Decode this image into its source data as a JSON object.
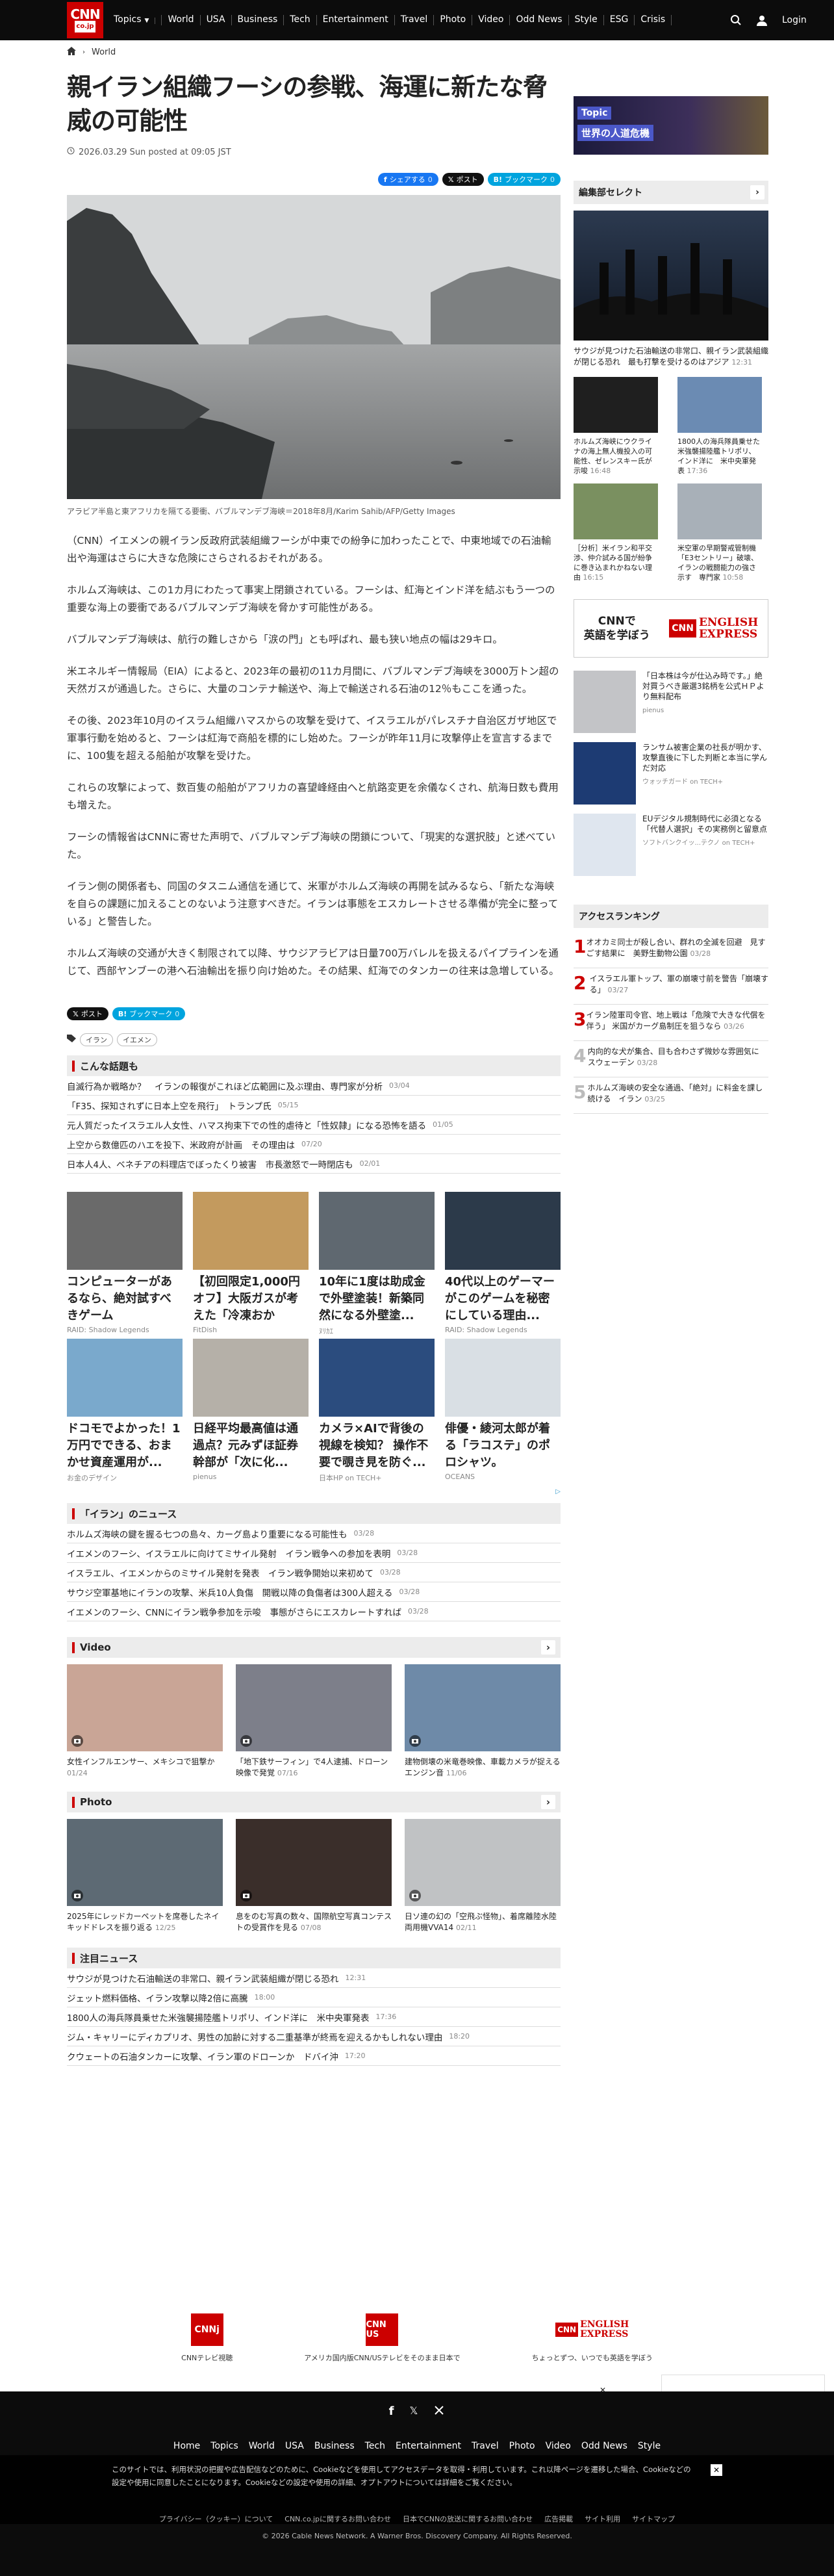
{
  "header": {
    "logo_main": "CNN",
    "logo_sub": "co.jp",
    "nav": [
      "Topics",
      "World",
      "USA",
      "Business",
      "Tech",
      "Entertainment",
      "Travel",
      "Photo",
      "Video",
      "Odd News",
      "Style",
      "ESG",
      "Crisis"
    ],
    "login": "Login"
  },
  "breadcrumb": {
    "section": "World"
  },
  "article": {
    "title": "親イラン組織フーシの参戦、海運に新たな脅威の可能性",
    "date": "2026.03.29 Sun posted at 09:05 JST",
    "share": {
      "facebook": "シェアする",
      "x": "ポスト",
      "hatena": "ブックマーク"
    },
    "caption": "アラビア半島と東アフリカを隔てる要衝、バブルマンデブ海峡＝2018年8月/Karim Sahib/AFP/Getty Images",
    "paragraphs": [
      "（CNN）イエメンの親イラン反政府武装組織フーシが中東での紛争に加わったことで、中東地域での石油輸出や海運はさらに大きな危険にさらされるおそれがある。",
      "ホルムズ海峡は、この1カ月にわたって事実上閉鎖されている。フーシは、紅海とインド洋を結ぶもう一つの重要な海上の要衝であるバブルマンデブ海峡を脅かす可能性がある。",
      "バブルマンデブ海峡は、航行の難しさから「涙の門」とも呼ばれ、最も狭い地点の幅は29キロ。",
      "米エネルギー情報局（EIA）によると、2023年の最初の11カ月間に、バブルマンデブ海峡を3000万トン超の天然ガスが通過した。さらに、大量のコンテナ輸送や、海上で輸送される石油の12％もここを通った。",
      "その後、2023年10月のイスラム組織ハマスからの攻撃を受けて、イスラエルがパレスチナ自治区ガザ地区で軍事行動を始めると、フーシは紅海で商船を標的にし始めた。フーシが昨年11月に攻撃停止を宣言するまでに、100隻を超える船舶が攻撃を受けた。",
      "これらの攻撃によって、数百隻の船舶がアフリカの喜望峰経由へと航路変更を余儀なくされ、航海日数も費用も増えた。",
      "フーシの情報省はCNNに寄せた声明で、バブルマンデブ海峡の閉鎖について、「現実的な選択肢」と述べていた。",
      "イラン側の関係者も、同国のタスニム通信を通じて、米軍がホルムズ海峡の再開を試みるなら、「新たな海峡を自らの課題に加えることのないよう注意すべきだ。イランは事態をエスカレートさせる準備が完全に整っている」と警告した。",
      "ホルムズ海峡の交通が大きく制限されて以降、サウジアラビアは日量700万バレルを扱えるパイプラインを通じて、西部ヤンブーの港へ石油輸出を振り向け始めた。その結果、紅海でのタンカーの往来は急増している。"
    ],
    "tags": [
      "イラン",
      "イエメン"
    ]
  },
  "related": {
    "heading": "こんな話題も",
    "items": [
      {
        "text": "自滅行為か戦略か？　イランの報復がこれほど広範囲に及ぶ理由、専門家が分析",
        "date": "03/04"
      },
      {
        "text": "「F35、探知されずに日本上空を飛行」　トランプ氏",
        "date": "05/15"
      },
      {
        "text": "元人質だったイスラエル人女性、ハマス拘束下での性的虐待と「性奴隷」になる恐怖を語る",
        "date": "01/05"
      },
      {
        "text": "上空から数億匹のハエを投下、米政府が計画　その理由は",
        "date": "07/20"
      },
      {
        "text": "日本人4人、ベネチアの料理店でぼったくり被害　市長激怒で一時閉店も",
        "date": "02/01"
      }
    ]
  },
  "ads": [
    {
      "title": "コンピューターがあるなら、絶対試すべきゲーム",
      "source": "RAID: Shadow Legends"
    },
    {
      "title": "【初回限定1,000円オフ】大阪ガスが考えた「冷凍おかず」...",
      "source": "FitDish"
    },
    {
      "title": "10年に1度は助成金で外壁塗装！新築同然になる外壁塗...",
      "source": "ﾇﾘｶｴ"
    },
    {
      "title": "40代以上のゲーマーがこのゲームを秘密にしている理由...",
      "source": "RAID: Shadow Legends"
    },
    {
      "title": "ドコモでよかった！1万円でできる、おまかせ資産運用が...",
      "source": "お金のデザイン"
    },
    {
      "title": "日経平均最高値は通過点？元みずほ証券幹部が「次に化...",
      "source": "pienus"
    },
    {
      "title": "カメラ×AIで背後の視線を検知？ 操作不要で覗き見を防ぐ...",
      "source": "日本HP on TECH+"
    },
    {
      "title": "俳優・綾河太郎が着る「ラコステ」のポロシャツ。",
      "source": "OCEANS"
    }
  ],
  "iran_news": {
    "heading": "「イラン」のニュース",
    "items": [
      {
        "text": "ホルムズ海峡の鍵を握る七つの島々、カーグ島より重要になる可能性も",
        "date": "03/28"
      },
      {
        "text": "イエメンのフーシ、イスラエルに向けてミサイル発射　イラン戦争への参加を表明",
        "date": "03/28"
      },
      {
        "text": "イスラエル、イエメンからのミサイル発射を発表　イラン戦争開始以来初めて",
        "date": "03/28"
      },
      {
        "text": "サウジ空軍基地にイランの攻撃、米兵10人負傷　開戦以降の負傷者は300人超える",
        "date": "03/28"
      },
      {
        "text": "イエメンのフーシ、CNNにイラン戦争参加を示唆　事態がさらにエスカレートすれば",
        "date": "03/28"
      }
    ]
  },
  "video": {
    "heading": "Video",
    "items": [
      {
        "text": "女性インフルエンサー、メキシコで狙撃か",
        "date": "01/24"
      },
      {
        "text": "「地下鉄サーフィン」で4人逮捕、ドローン映像で発覚",
        "date": "07/16"
      },
      {
        "text": "建物倒壊の米竜巻映像、車載カメラが捉える　エンジン音",
        "date": "11/06"
      }
    ]
  },
  "photo": {
    "heading": "Photo",
    "items": [
      {
        "text": "2025年にレッドカーペットを席巻したネイキッドドレスを振り返る",
        "date": "12/25"
      },
      {
        "text": "息をのむ写真の数々、国際航空写真コンテストの受賞作を見る",
        "date": "07/08"
      },
      {
        "text": "日ソ連の幻の「空飛ぶ怪物」、着席離陸水陸両用機VVA14",
        "date": "02/11"
      }
    ]
  },
  "featured": {
    "heading": "注目ニュース",
    "items": [
      {
        "text": "サウジが見つけた石油輸送の非常口、親イラン武装組織が閉じる恐れ",
        "date": "12:31"
      },
      {
        "text": "ジェット燃料価格、イラン攻撃以降2倍に高騰",
        "date": "18:00"
      },
      {
        "text": "1800人の海兵隊員乗せた米強襲揚陸艦トリポリ、インド洋に　米中央軍発表",
        "date": "17:36"
      },
      {
        "text": "ジム・キャリーにディカプリオ、男性の加齢に対する二重基準が終焉を迎えるかもしれない理由",
        "date": "18:20"
      },
      {
        "text": "クウェートの石油タンカーに攻撃、イラン軍のドローンか　ドバイ沖",
        "date": "17:20"
      }
    ]
  },
  "sidebar": {
    "topic_banner": {
      "label": "Topic",
      "title": "世界の人道危機"
    },
    "editors": {
      "heading": "編集部セレクト",
      "lead": {
        "text": "サウジが見つけた石油輸送の非常口、親イラン武装組織が閉じる恐れ　最も打撃を受けるのはアジア",
        "date": "12:31"
      },
      "items": [
        {
          "text": "ホルムズ海峡にウクライナの海上無人機投入の可能性、ゼレンスキー氏が示唆",
          "date": "16:48"
        },
        {
          "text": "1800人の海兵隊員乗せた米強襲揚陸艦トリポリ、インド洋に　米中央軍発表",
          "date": "17:36"
        },
        {
          "text": "［分析］米イラン和平交渉、仲介試みる国が紛争に巻き込まれかねない理由",
          "date": "16:15"
        },
        {
          "text": "米空軍の早期警戒管制機「E3セントリー」破壊、イランの戦闘能力の強さ示す　専門家",
          "date": "10:58"
        }
      ]
    },
    "cnn_english": {
      "l1": "CNNで",
      "l2": "英語を学ぼう",
      "brand1": "ENGLISH",
      "brand2": "EXPRESS"
    },
    "promo": [
      {
        "text": "「日本株は今が仕込み時です。」絶対買うべき厳選3銘柄を公式ＨＰより無料配布",
        "source": "pienus"
      },
      {
        "text": "ランサム被害企業の社長が明かす、攻撃直後に下した判断と本当に学んだ対応",
        "source": "ウォッチガード on TECH+"
      },
      {
        "text": "EUデジタル規制時代に必須となる「代替人選択」その実務例と留意点",
        "source": "ソフトバンクイッ...テクノ on TECH+"
      }
    ],
    "ranking": {
      "heading": "アクセスランキング",
      "items": [
        {
          "rank": "1",
          "text": "オオカミ同士が殺し合い、群れの全滅を回避　見すごす結果に　美野生動物公園",
          "date": "03/28"
        },
        {
          "rank": "2",
          "text": "イスラエル軍トップ、軍の崩壊寸前を警告「崩壊する」",
          "date": "03/27"
        },
        {
          "rank": "3",
          "text": "イラン陸軍司令官、地上戦は「危険で大きな代償を伴う」 米国がカーグ島制圧を狙うなら",
          "date": "03/26"
        },
        {
          "rank": "4",
          "text": "内向的な犬が集合、目も合わさず微妙な雰囲気に　スウェーデン",
          "date": "03/28"
        },
        {
          "rank": "5",
          "text": "ホルムズ海峡の安全な通過、「絶対」に料金を課し続ける　イラン",
          "date": "03/25"
        }
      ]
    }
  },
  "footer_logos": [
    {
      "label": "CNNテレビ視聴"
    },
    {
      "label": "アメリカ国内版CNN/USテレビをそのまま日本で"
    },
    {
      "label": "ちょっとずつ、いつでも英語を学ぼう"
    }
  ],
  "footer": {
    "nav": [
      "Home",
      "Topics",
      "World",
      "USA",
      "Business",
      "Tech",
      "Entertainment",
      "Travel",
      "Photo",
      "Video",
      "Odd News",
      "Style"
    ],
    "cookie": "このサイトでは、利用状況の把握や広告配信などのために、Cookieなどを使用してアクセスデータを取得・利用しています。これ以降ページを遷移した場合、Cookieなどの設定や使用に同意したことになります。Cookieなどの設定や使用の詳細、オプトアウトについては詳細をご覧ください。",
    "legal": [
      "プライバシー（クッキー）について",
      "CNN.co.jpに関するお問い合わせ",
      "日本でCNNの放送に関するお問い合わせ",
      "広告掲載",
      "サイト利用",
      "サイトマップ"
    ],
    "copyright": "© 2026 Cable News Network. A Warner Bros. Discovery Company. All Rights Reserved."
  }
}
